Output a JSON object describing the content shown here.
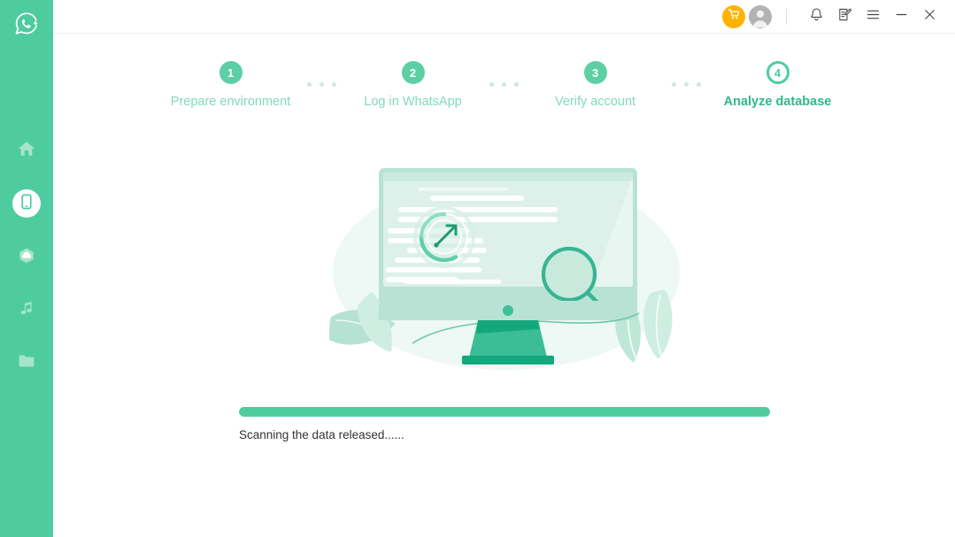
{
  "app": {
    "logo_icon": "whatsapp-logo-icon",
    "accent_color": "#4ecca0",
    "sidebar_color": "#4ecca0",
    "cart_color": "#ffb300"
  },
  "sidebar": {
    "items": [
      {
        "name": "home",
        "icon": "home-icon",
        "active": false
      },
      {
        "name": "device",
        "icon": "phone-icon",
        "active": true
      },
      {
        "name": "backup",
        "icon": "cloud-icon",
        "active": false
      },
      {
        "name": "music",
        "icon": "music-note-icon",
        "active": false
      },
      {
        "name": "files",
        "icon": "folder-icon",
        "active": false
      }
    ]
  },
  "titlebar": {
    "cart_icon": "shopping-cart-icon",
    "avatar_icon": "user-avatar-icon",
    "bell_icon": "bell-icon",
    "feedback_icon": "edit-note-icon",
    "menu_icon": "hamburger-menu-icon",
    "minimize_icon": "minimize-icon",
    "close_icon": "close-icon"
  },
  "steps": [
    {
      "number": "1",
      "label": "Prepare environment",
      "state": "done"
    },
    {
      "number": "2",
      "label": "Log in WhatsApp",
      "state": "done"
    },
    {
      "number": "3",
      "label": "Verify account",
      "state": "done"
    },
    {
      "number": "4",
      "label": "Analyze database",
      "state": "current"
    }
  ],
  "illustration": {
    "name": "database-scanning-illustration",
    "monitor_icon": "desktop-monitor-icon",
    "gauge_icon": "speedometer-gauge-icon",
    "search_icon": "magnifying-glass-icon",
    "plant_icon": "leaf-icon"
  },
  "progress": {
    "percent": 100,
    "percent_label": "100%",
    "status_text": "Scanning the data released......"
  }
}
